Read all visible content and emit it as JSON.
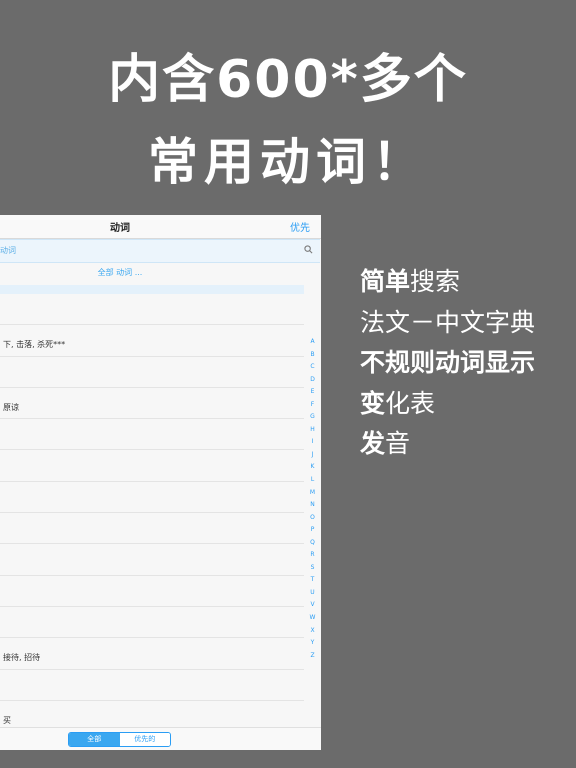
{
  "headline": {
    "line1": "内含600*多个",
    "line2": "常用动词！"
  },
  "features": [
    {
      "bold": "简单",
      "rest": "搜索"
    },
    {
      "bold": "",
      "rest": "法文－中文字典"
    },
    {
      "bold": "不规则动词显示",
      "rest": ""
    },
    {
      "bold": "变",
      "rest": "化表"
    },
    {
      "bold": "发",
      "rest": "音"
    }
  ],
  "app": {
    "nav_title": "动词",
    "nav_priority": "优先",
    "search_text": "动词",
    "section_header": "全部 动词 ...",
    "rows": [
      "",
      "下, 击落, 杀死***",
      "",
      "原谅",
      "",
      "",
      "",
      "",
      "",
      "",
      "",
      "接待, 招待",
      "",
      "买",
      ""
    ],
    "index_letters": [
      "A",
      "B",
      "C",
      "D",
      "E",
      "F",
      "G",
      "H",
      "I",
      "J",
      "K",
      "L",
      "M",
      "N",
      "O",
      "P",
      "Q",
      "R",
      "S",
      "T",
      "U",
      "V",
      "W",
      "X",
      "Y",
      "Z"
    ],
    "tabs": {
      "all": "全部",
      "priority": "优先的"
    }
  }
}
